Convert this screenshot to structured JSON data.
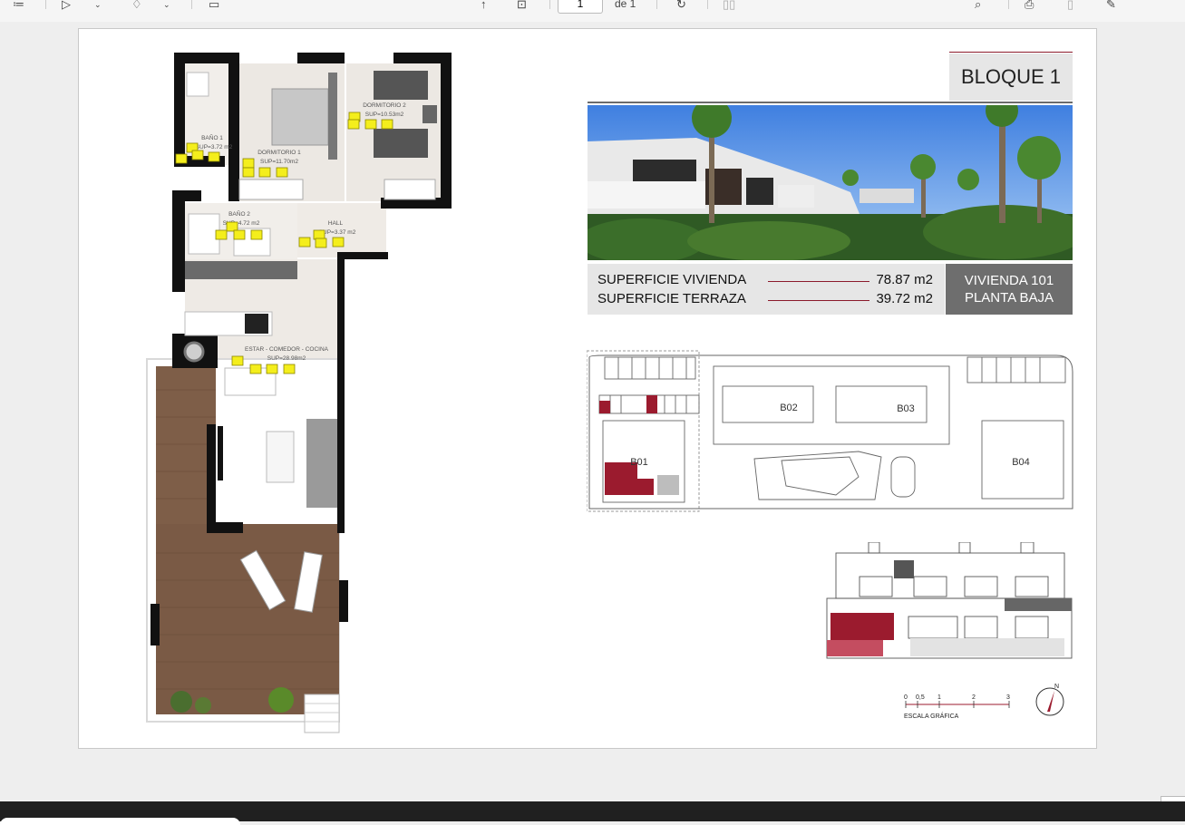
{
  "toolbar": {
    "page_current": "1",
    "page_of": "de 1"
  },
  "document": {
    "bloque_title": "BLOQUE 1",
    "surface_rows": [
      {
        "label": "SUPERFICIE VIVIENDA",
        "value": "78.87 m2"
      },
      {
        "label": "SUPERFICIE TERRAZA",
        "value": "39.72 m2"
      }
    ],
    "vivienda_line1": "VIVIENDA 101",
    "vivienda_line2": "PLANTA BAJA",
    "site_blocks": [
      "B01",
      "B02",
      "B03",
      "B04"
    ],
    "rooms": {
      "bano1_name": "BAÑO 1",
      "bano1_sup": "SUP=3.72 m2",
      "dorm1_name": "DORMITORIO 1",
      "dorm1_sup": "SUP=11.70m2",
      "dorm2_name": "DORMITORIO 2",
      "dorm2_sup": "SUP=10.53m2",
      "bano2_name": "BAÑO 2",
      "bano2_sup": "SUP=4.72 m2",
      "hall_name": "HALL",
      "hall_sup": "SUP=3.37 m2",
      "estar_name": "ESTAR - COMEDOR - COCINA",
      "estar_sup": "SUP=28.98m2"
    },
    "scale": {
      "ticks": [
        "0",
        "0,5",
        "1",
        "2",
        "3"
      ],
      "label": "ESCALA GRÁFICA",
      "north": "N"
    }
  },
  "colors": {
    "accent_red": "#9b1b2e",
    "panel_grey": "#6e6e6e",
    "comment_yellow": "#f4ee1c",
    "wall": "#111111",
    "deck_wood": "#7a5a45"
  },
  "icons": [
    "menu-icon",
    "pen-icon",
    "highlighter-icon",
    "save-icon",
    "fit-page-icon",
    "rotate-icon",
    "two-page-icon",
    "search-icon",
    "print-icon",
    "save-copy-icon",
    "edit-icon",
    "comment-icon"
  ]
}
